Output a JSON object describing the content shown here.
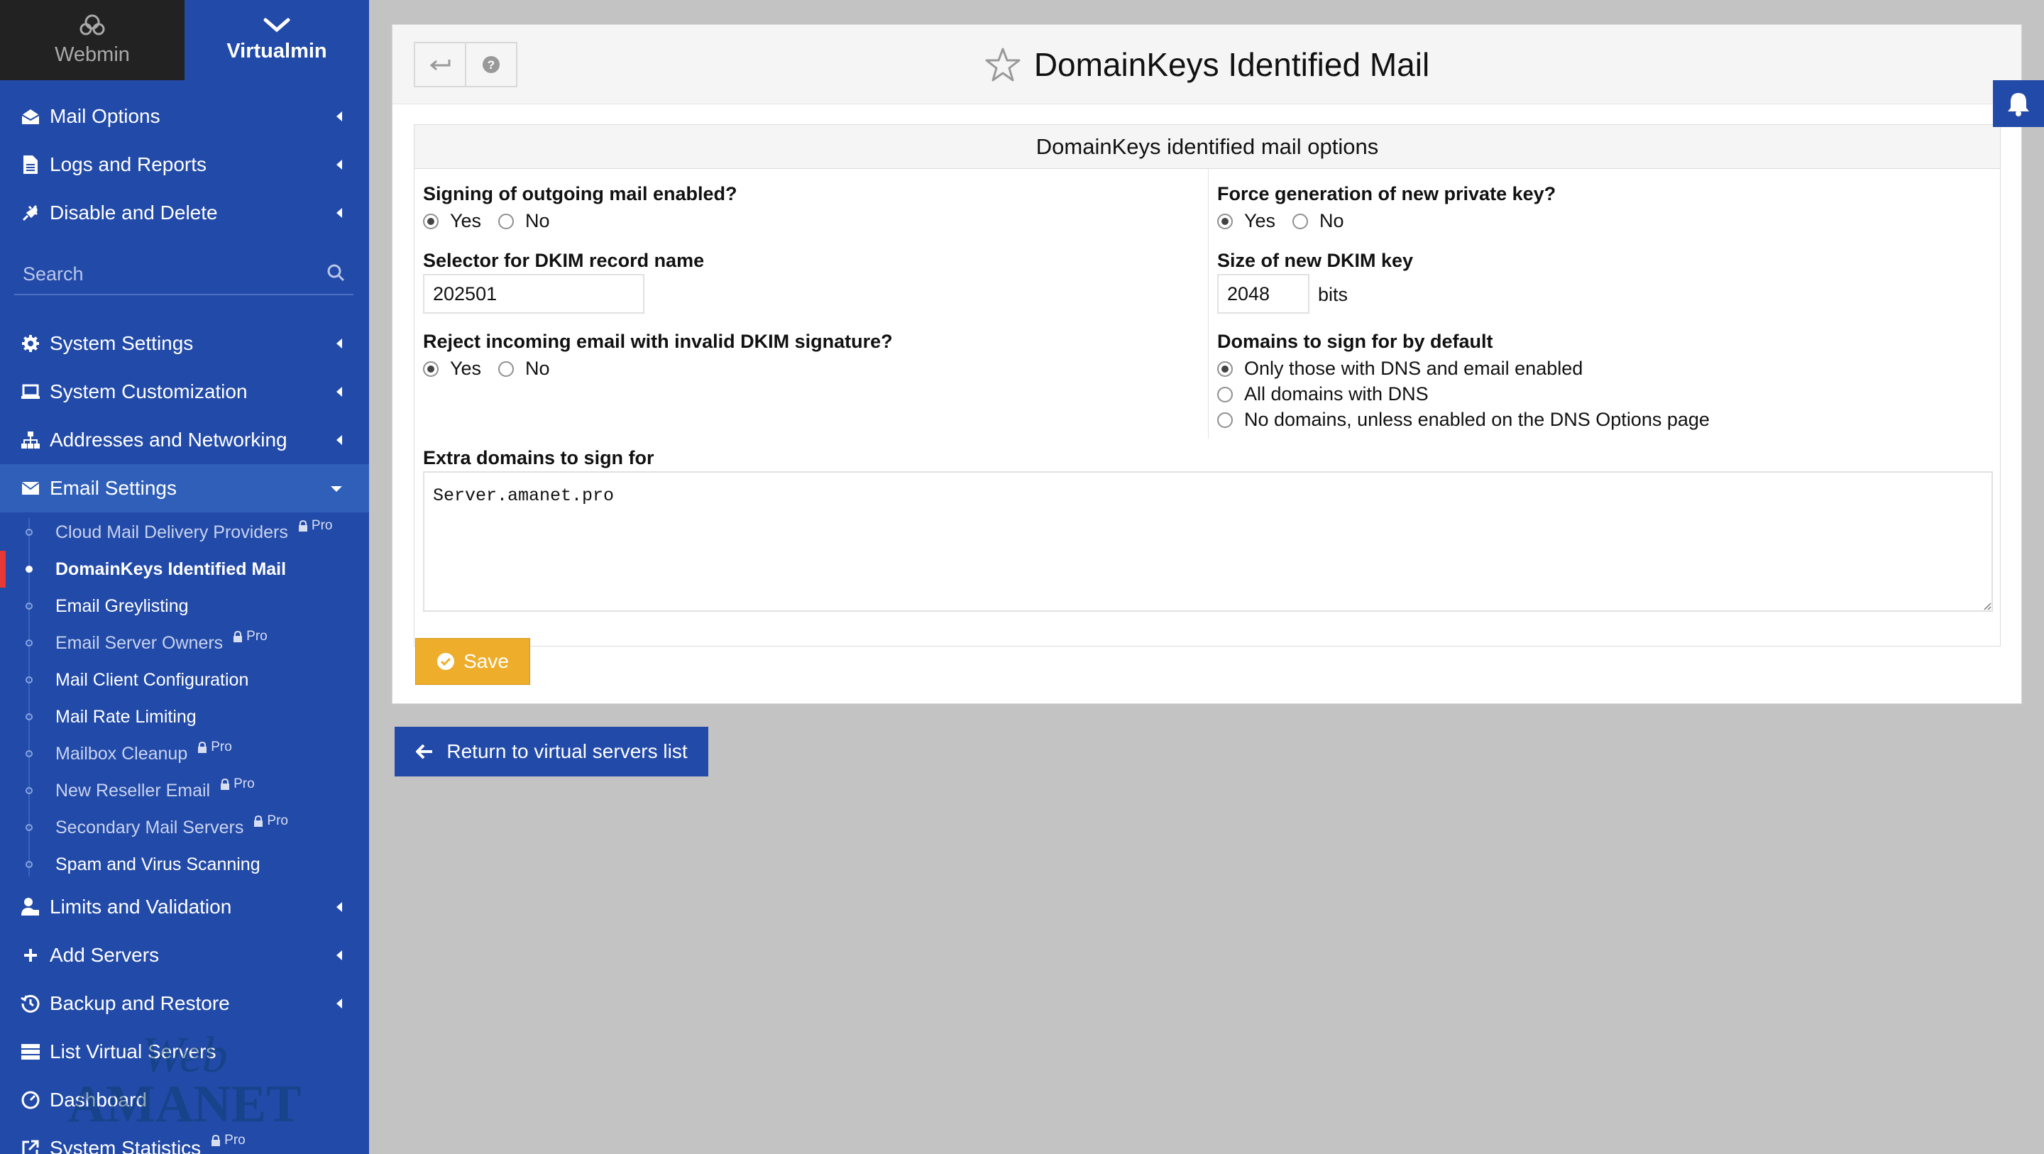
{
  "sidebar": {
    "switch": {
      "webmin": "Webmin",
      "virtualmin": "Virtualmin"
    },
    "top_items": [
      "Mail Options",
      "Logs and Reports",
      "Disable and Delete"
    ],
    "search_placeholder": "Search",
    "items": [
      "System Settings",
      "System Customization",
      "Addresses and Networking",
      "Email Settings"
    ],
    "email_sub": [
      {
        "label": "Cloud Mail Delivery Providers",
        "pro": "Pro"
      },
      {
        "label": "DomainKeys Identified Mail"
      },
      {
        "label": "Email Greylisting"
      },
      {
        "label": "Email Server Owners",
        "pro": "Pro"
      },
      {
        "label": "Mail Client Configuration"
      },
      {
        "label": "Mail Rate Limiting"
      },
      {
        "label": "Mailbox Cleanup",
        "pro": "Pro"
      },
      {
        "label": "New Reseller Email",
        "pro": "Pro"
      },
      {
        "label": "Secondary Mail Servers",
        "pro": "Pro"
      },
      {
        "label": "Spam and Virus Scanning"
      }
    ],
    "bottom_items": [
      "Limits and Validation",
      "Add Servers",
      "Backup and Restore",
      "List Virtual Servers",
      "Dashboard",
      "System Statistics"
    ],
    "bottom_pro": "Pro",
    "watermark_text": "Web AMANET"
  },
  "header": {
    "title": "DomainKeys Identified Mail"
  },
  "options": {
    "section_title": "DomainKeys identified mail options",
    "signing_label": "Signing of outgoing mail enabled?",
    "yes": "Yes",
    "no": "No",
    "selector_label": "Selector for DKIM record name",
    "selector_value": "202501",
    "reject_label": "Reject incoming email with invalid DKIM signature?",
    "force_label": "Force generation of new private key?",
    "size_label": "Size of new DKIM key",
    "size_value": "2048",
    "size_unit": "bits",
    "domains_label": "Domains to sign for by default",
    "domains_options": [
      "Only those with DNS and email enabled",
      "All domains with DNS",
      "No domains, unless enabled on the DNS Options page"
    ],
    "extra_label": "Extra domains to sign for",
    "extra_value": "Server.amanet.pro"
  },
  "buttons": {
    "save": "Save",
    "return": "Return to virtual servers list"
  },
  "colors": {
    "sidebar": "#224aa8",
    "save": "#eeae2b",
    "active_marker": "#e53935"
  }
}
